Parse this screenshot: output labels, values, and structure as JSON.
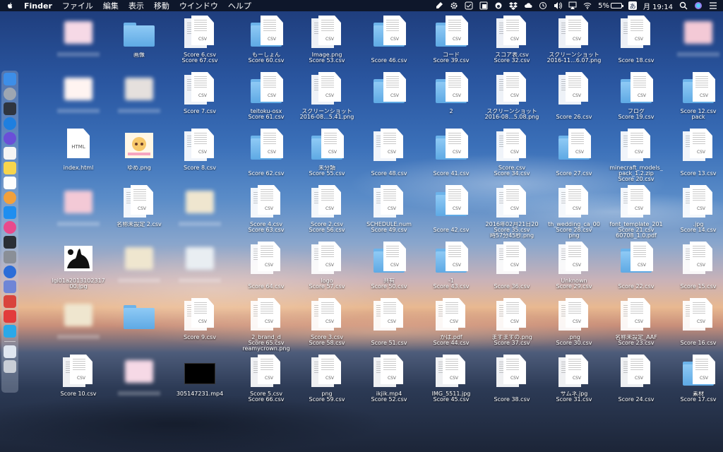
{
  "menubar": {
    "app_name": "Finder",
    "menus": [
      "ファイル",
      "編集",
      "表示",
      "移動",
      "ウインドウ",
      "ヘルプ"
    ],
    "battery": "5%",
    "input_method": "あ",
    "clock": "月 19:14"
  },
  "desktop": {
    "col1": [
      {
        "type": "blur"
      },
      {
        "type": "blur"
      },
      {
        "type": "html",
        "ext": "HTML",
        "label": "index.html"
      },
      {
        "type": "blur"
      },
      {
        "type": "image-cat",
        "label": "lgi01a2013102317",
        "label2": "00.jpg"
      },
      {
        "type": "blur"
      },
      {
        "type": "csv",
        "ext": "CSV",
        "label": "Score 10.csv"
      }
    ],
    "col2": [
      {
        "type": "folder",
        "label": "画像"
      },
      {
        "type": "blur"
      },
      {
        "type": "image-anime",
        "label": "ゆめ.png"
      },
      {
        "type": "csv",
        "ext": "CSV",
        "label": "名称未設定 2.csv"
      },
      {
        "type": "blur"
      },
      {
        "type": "folder-blur"
      },
      {
        "type": "blur"
      }
    ],
    "col3": [
      {
        "type": "csv",
        "ext": "CSV",
        "label": "Score 6.csv",
        "label2": "Score 67.csv"
      },
      {
        "type": "csv",
        "ext": "CSV",
        "label": "Score 7.csv"
      },
      {
        "type": "csv",
        "ext": "CSV",
        "label": "Score 8.csv"
      },
      {
        "type": "blur"
      },
      {
        "type": "blur"
      },
      {
        "type": "csv",
        "ext": "CSV",
        "label": "Score 9.csv"
      },
      {
        "type": "video",
        "label": "305147231.mp4"
      }
    ],
    "col4": [
      {
        "type": "folder-csv",
        "ext": "CSV",
        "label": "もーしょん",
        "label2": "Score 60.csv"
      },
      {
        "type": "folder-csv",
        "ext": "CSV",
        "label": "teitoku-osx",
        "label2": "Score 61.csv"
      },
      {
        "type": "folder-csv",
        "ext": "CSV",
        "label2": "Score 62.csv"
      },
      {
        "type": "csv",
        "ext": "CSV",
        "label": "Score 4.csv",
        "label2": "Score 63.csv"
      },
      {
        "type": "csv",
        "ext": "CSV",
        "label2": "Score 64.csv"
      },
      {
        "type": "csv",
        "ext": "CSV",
        "label": "2_brand_d",
        "label2": "Score 65.csv",
        "label3": "reamycrown.png"
      },
      {
        "type": "csv",
        "ext": "CSV",
        "label": "Score 5.csv",
        "label2": "Score 66.csv"
      }
    ],
    "col5": [
      {
        "type": "csv",
        "ext": "CSV",
        "label": "Image.png",
        "label2": "Score 53.csv"
      },
      {
        "type": "csv",
        "ext": "CSV",
        "label": "スクリーンショット",
        "label2": "2016-08...5.41.png"
      },
      {
        "type": "folder-csv",
        "ext": "CSV",
        "label": "未分類",
        "label2": "Score 55.csv"
      },
      {
        "type": "csv",
        "ext": "CSV",
        "label": "Score 2.csv",
        "label2": "Score 56.csv"
      },
      {
        "type": "csv",
        "ext": "CSV",
        "label": "logo",
        "label2": "Score 57.csv"
      },
      {
        "type": "csv",
        "ext": "CSV",
        "label": "Score 3.csv",
        "label2": "Score 58.csv"
      },
      {
        "type": "csv",
        "ext": "CSV",
        "label": "png",
        "label2": "Score 59.csv"
      }
    ],
    "col6": [
      {
        "type": "folder-csv",
        "ext": "CSV",
        "label2": "Score 46.csv"
      },
      {
        "type": "folder-csv",
        "ext": "CSV"
      },
      {
        "type": "csv",
        "ext": "CSV",
        "label2": "Score 48.csv"
      },
      {
        "type": "csv",
        "ext": "CSV",
        "label": "SCHEDULE.num",
        "label2": "Score 49.csv"
      },
      {
        "type": "folder-csv",
        "ext": "CSV",
        "label": "共有",
        "label2": "Score 50.csv"
      },
      {
        "type": "csv",
        "ext": "CSV",
        "label2": "Score 51.csv"
      },
      {
        "type": "csv",
        "ext": "CSV",
        "label": "ikjik.mp4",
        "label2": "Score 52.csv"
      }
    ],
    "col7": [
      {
        "type": "folder-csv",
        "ext": "CSV",
        "label": "コード",
        "label2": "Score 39.csv"
      },
      {
        "type": "folder-csv",
        "ext": "CSV",
        "label": "2"
      },
      {
        "type": "folder-csv",
        "ext": "CSV",
        "label2": "Score 41.csv"
      },
      {
        "type": "folder-csv",
        "ext": "CSV",
        "label2": "Score 42.csv"
      },
      {
        "type": "folder-csv",
        "ext": "CSV",
        "label": "-1",
        "label2": "Score 43.csv"
      },
      {
        "type": "csv",
        "ext": "CSV",
        "label": "かば.pdf",
        "label2": "Score 44.csv"
      },
      {
        "type": "csv",
        "ext": "CSV",
        "label": "IMG_5511.jpg",
        "label2": "Score 45.csv"
      }
    ],
    "col8": [
      {
        "type": "csv",
        "ext": "CSV",
        "label": "スコア表.csv",
        "label2": "Score 32.csv"
      },
      {
        "type": "csv",
        "ext": "CSV",
        "label": "スクリーンショット",
        "label2": "2016-08...5.08.png"
      },
      {
        "type": "csv",
        "ext": "CSV",
        "label": "Score.csv",
        "label2": "Score 34.csv"
      },
      {
        "type": "csv",
        "ext": "CSV",
        "label": "2016年02月21日20",
        "label2": "Score 35.csv",
        "label3": "時57分45秒.png"
      },
      {
        "type": "csv",
        "ext": "CSV",
        "label2": "Score 36.csv"
      },
      {
        "type": "csv",
        "ext": "CSV",
        "label": "ますますの.png",
        "label2": "Score 37.csv"
      },
      {
        "type": "csv",
        "ext": "CSV",
        "label2": "Score 38.csv"
      }
    ],
    "col9": [
      {
        "type": "csv",
        "ext": "CSV",
        "label": "スクリーンショット",
        "label2": "2016-11...6.07.png"
      },
      {
        "type": "csv",
        "ext": "CSV",
        "label2": "Score 26.csv"
      },
      {
        "type": "folder-csv",
        "ext": "CSV",
        "label2": "Score 27.csv"
      },
      {
        "type": "csv",
        "ext": "CSV",
        "label": "th_wedding_ca_00",
        "label2": "Score 28.csv",
        "label3": "png"
      },
      {
        "type": "csv",
        "ext": "CSV",
        "label": "Unknown",
        "label2": "Score 29.csv"
      },
      {
        "type": "csv",
        "ext": "CSV",
        "label": ".png",
        "label2": "Score 30.csv"
      },
      {
        "type": "csv",
        "ext": "CSV",
        "label": "サムネ.jpg",
        "label2": "Score 31.csv"
      }
    ],
    "col10": [
      {
        "type": "csv",
        "ext": "CSV",
        "label2": "Score 18.csv"
      },
      {
        "type": "folder-csv",
        "ext": "CSV",
        "label": "ブログ",
        "label2": "Score 19.csv"
      },
      {
        "type": "csv",
        "ext": "CSV",
        "label": "minecraft_models_",
        "label2": "pack_1.2.zip",
        "label3": "Score 20.csv"
      },
      {
        "type": "csv",
        "ext": "CSV",
        "label": "font_template_201",
        "label2": "Score 21.csv",
        "label3": "60708_1.0.pdf"
      },
      {
        "type": "folder-csv",
        "ext": "CSV",
        "label2": "Score 22.csv"
      },
      {
        "type": "csv",
        "ext": "CSV",
        "label": "名称未設定_AAF",
        "label2": "Score 23.csv"
      },
      {
        "type": "csv",
        "ext": "CSV",
        "label2": "Score 24.csv"
      }
    ],
    "col11": [
      {
        "type": "blur"
      },
      {
        "type": "folder-csv",
        "ext": "CSV",
        "label": "Score 12.csv",
        "label2": "pack"
      },
      {
        "type": "csv",
        "ext": "CSV",
        "label2": "Score 13.csv"
      },
      {
        "type": "csv",
        "ext": "CSV",
        "label": ".jpg",
        "label2": "Score 14.csv"
      },
      {
        "type": "csv",
        "ext": "CSV",
        "label2": "Score 15.csv"
      },
      {
        "type": "csv",
        "ext": "CSV",
        "label2": "Score 16.csv"
      },
      {
        "type": "folder-csv",
        "ext": "CSV",
        "label": "素材",
        "label2": "Score 17.csv"
      }
    ]
  },
  "dock": {
    "icons": [
      {
        "name": "finder-icon",
        "color": "#3d8ee8"
      },
      {
        "name": "launchpad-icon",
        "color": "#9ea6b2"
      },
      {
        "name": "mission-control-icon",
        "color": "#2f3540"
      },
      {
        "name": "safari-icon",
        "color": "#1e7fe0"
      },
      {
        "name": "siri-icon",
        "color": "#6a4fd8"
      },
      {
        "name": "calendar-icon",
        "color": "#f4f4f4"
      },
      {
        "name": "notes-icon",
        "color": "#f8d54c"
      },
      {
        "name": "reminders-icon",
        "color": "#fdfdfd"
      },
      {
        "name": "photos-icon",
        "color": "#f2a03c"
      },
      {
        "name": "app-store-icon",
        "color": "#1e8ef0"
      },
      {
        "name": "itunes-icon",
        "color": "#e94a8c"
      },
      {
        "name": "activity-monitor-icon",
        "color": "#2a2f36"
      },
      {
        "name": "system-preferences-icon",
        "color": "#8a8f97"
      },
      {
        "name": "chrome-icon",
        "color": "#2b6dd8"
      },
      {
        "name": "discord-icon",
        "color": "#6f85d6"
      },
      {
        "name": "video-app-icon",
        "color": "#d9443c"
      },
      {
        "name": "vivaldi-icon",
        "color": "#e23b3b"
      },
      {
        "name": "skype-icon",
        "color": "#2aa8e8"
      },
      {
        "name": "downloads-folder-icon",
        "color": "#dfe6f0"
      },
      {
        "name": "trash-icon",
        "color": "#c9ced6"
      }
    ]
  }
}
